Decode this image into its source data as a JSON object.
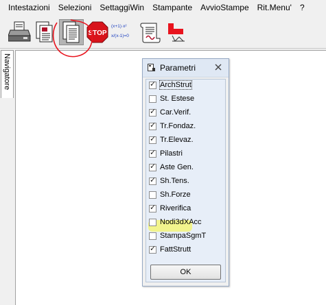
{
  "menu": [
    "Intestazioni",
    "Selezioni",
    "SettaggiWin",
    "Stampante",
    "AvvioStampe",
    "Rit.Menu'",
    "?"
  ],
  "toolbar": {
    "buttons": [
      {
        "name": "printer-icon"
      },
      {
        "name": "print-document-icon"
      },
      {
        "name": "print-pages-icon",
        "active": true
      },
      {
        "name": "stop-icon",
        "label": "STOP"
      },
      {
        "name": "formula-icon",
        "label1": "(x+1)·x²",
        "label2": "x/(x-1)=0"
      },
      {
        "name": "certificate-icon"
      },
      {
        "name": "return-icon"
      }
    ]
  },
  "navigator": {
    "label": "Navigatore"
  },
  "dialog": {
    "title": "Parametri",
    "items": [
      {
        "label": "ArchStrut",
        "checked": true
      },
      {
        "label": "St. Estese",
        "checked": false
      },
      {
        "label": "Car.Verif.",
        "checked": true
      },
      {
        "label": "Tr.Fondaz.",
        "checked": true
      },
      {
        "label": "Tr.Elevaz.",
        "checked": true
      },
      {
        "label": "Pilastri",
        "checked": true
      },
      {
        "label": "Aste Gen.",
        "checked": true
      },
      {
        "label": "Sh.Tens.",
        "checked": true
      },
      {
        "label": "Sh.Forze",
        "checked": false
      },
      {
        "label": "Riverifica",
        "checked": true
      },
      {
        "label": "Nodi3dXAcc",
        "checked": false
      },
      {
        "label": "StampaSgmT",
        "checked": false
      },
      {
        "label": "FattStrutt",
        "checked": true
      }
    ],
    "ok_label": "OK"
  },
  "colors": {
    "highlight": "#f3f57a",
    "annotation": "#e8141e",
    "dialog_bg": "#e7eef8"
  }
}
